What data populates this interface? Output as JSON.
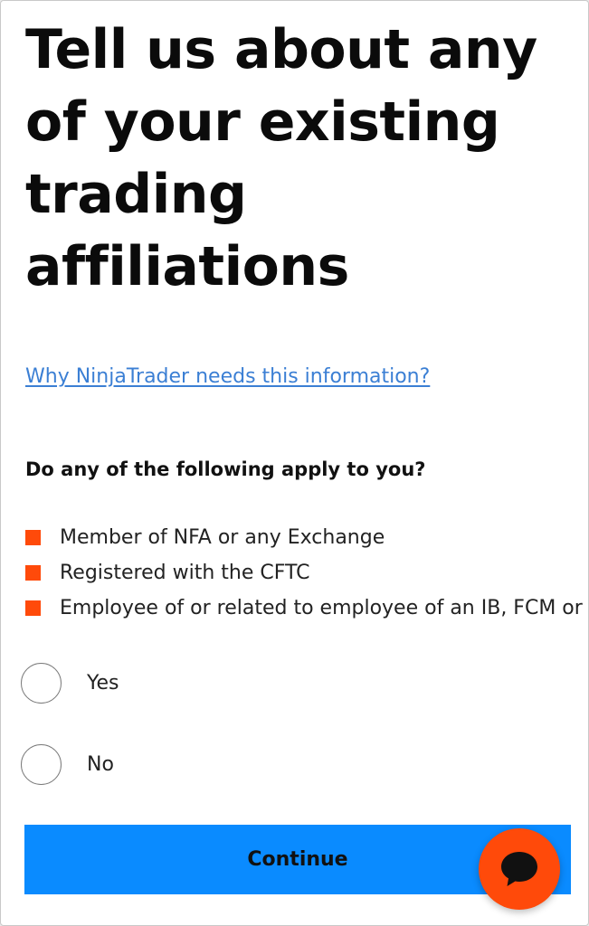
{
  "header": {
    "title": "Tell us about any of your existing trading affiliations"
  },
  "info_link": {
    "label": "Why NinjaTrader needs this information?"
  },
  "question": {
    "label": "Do any of the following apply to you?"
  },
  "affiliations": [
    {
      "label": "Member of NFA or any Exchange"
    },
    {
      "label": "Registered with the CFTC"
    },
    {
      "label": "Employee of or related to employee of an IB, FCM or Exchange"
    }
  ],
  "options": [
    {
      "label": "Yes",
      "selected": false
    },
    {
      "label": "No",
      "selected": false
    }
  ],
  "actions": {
    "continue_label": "Continue"
  },
  "chat": {
    "icon": "chat-bubble-icon"
  },
  "colors": {
    "accent": "#ff4a0a",
    "primary_button": "#0a8bff",
    "link": "#3b7fd4"
  }
}
